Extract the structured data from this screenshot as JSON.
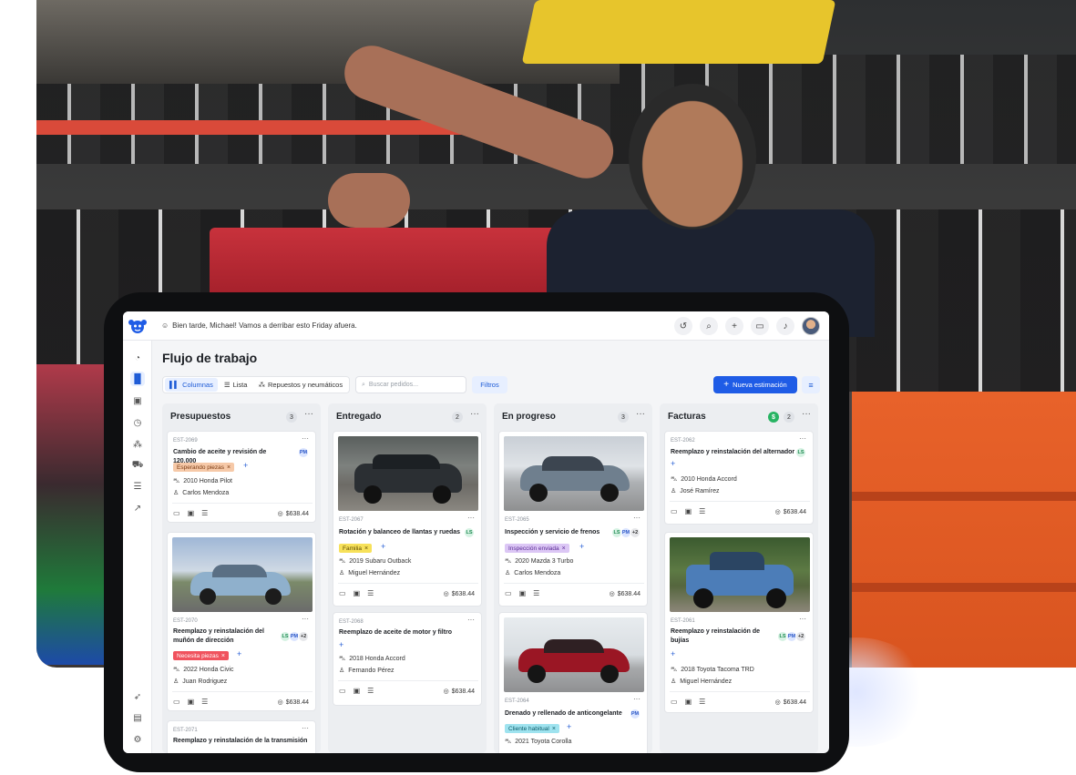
{
  "topbar": {
    "greeting": "Bien tarde, Michael! Vamos a derribar esto Friday afuera."
  },
  "page": {
    "title": "Flujo de trabajo"
  },
  "toolbar": {
    "views": [
      "Columnas",
      "Lista",
      "Repuestos y neumáticos"
    ],
    "search_placeholder": "Buscar pedidos...",
    "filters_label": "Filtros",
    "new_estimate_label": "Nueva estimación"
  },
  "columns": [
    {
      "title": "Presupuestos",
      "count": "3",
      "cards": [
        {
          "code": "EST-2069",
          "title": "Cambio de aceite y revisión de 120,000",
          "tag": "Esperando piezas",
          "vehicle": "2010 Honda Pilot",
          "person": "Carlos Mendoza",
          "price": "$638.44",
          "avatars": [
            "PM"
          ]
        },
        {
          "code": "EST-2070",
          "title": "Reemplazo y reinstalación del muñón de dirección",
          "tag": "Necesita piezas",
          "vehicle": "2022 Honda Civic",
          "person": "Juan Rodriguez",
          "price": "$638.44",
          "avatars": [
            "LS",
            "PM",
            "+2"
          ]
        },
        {
          "code": "EST-2071",
          "title": "Reemplazo y reinstalación de la transmisión"
        }
      ]
    },
    {
      "title": "Entregado",
      "count": "2",
      "cards": [
        {
          "code": "EST-2067",
          "title": "Rotación y balanceo de llantas y ruedas",
          "tag": "Familia",
          "vehicle": "2019 Subaru Outback",
          "person": "Miguel Hernández",
          "price": "$638.44",
          "avatars": [
            "LS"
          ]
        },
        {
          "code": "EST-2068",
          "title": "Reemplazo de aceite de motor y filtro",
          "vehicle": "2018 Honda Accord",
          "person": "Fernando Pérez",
          "price": "$638.44"
        }
      ]
    },
    {
      "title": "En progreso",
      "count": "3",
      "cards": [
        {
          "code": "EST-2065",
          "title": "Inspección y servicio de frenos",
          "tag": "Inspección enviada",
          "vehicle": "2020 Mazda 3 Turbo",
          "person": "Carlos Mendoza",
          "price": "$638.44",
          "avatars": [
            "LS",
            "PM",
            "+2"
          ]
        },
        {
          "code": "EST-2064",
          "title": "Drenado y rellenado de anticongelante",
          "tag": "Cliente habitual",
          "vehicle": "2021 Toyota Corolla",
          "avatars": [
            "PM"
          ]
        }
      ]
    },
    {
      "title": "Facturas",
      "count": "2",
      "badge": "$",
      "cards": [
        {
          "code": "EST-2062",
          "title": "Reemplazo y reinstalación del alternador",
          "vehicle": "2010 Honda Accord",
          "person": "José Ramírez",
          "price": "$638.44",
          "avatars": [
            "LS"
          ]
        },
        {
          "code": "EST-2061",
          "title": "Reemplazo y reinstalación de bujías",
          "vehicle": "2018 Toyota Tacoma TRD",
          "person": "Miguel Hernández",
          "price": "$638.44",
          "avatars": [
            "LS",
            "PM",
            "+2"
          ]
        }
      ]
    }
  ],
  "colors": {
    "primary": "#1f5ce6",
    "tag_orange": "#f6c9a8",
    "tag_red": "#f0535e",
    "tag_yellow": "#f7e15a",
    "tag_purple": "#dcc7f5",
    "tag_cyan": "#9fe3ef"
  }
}
